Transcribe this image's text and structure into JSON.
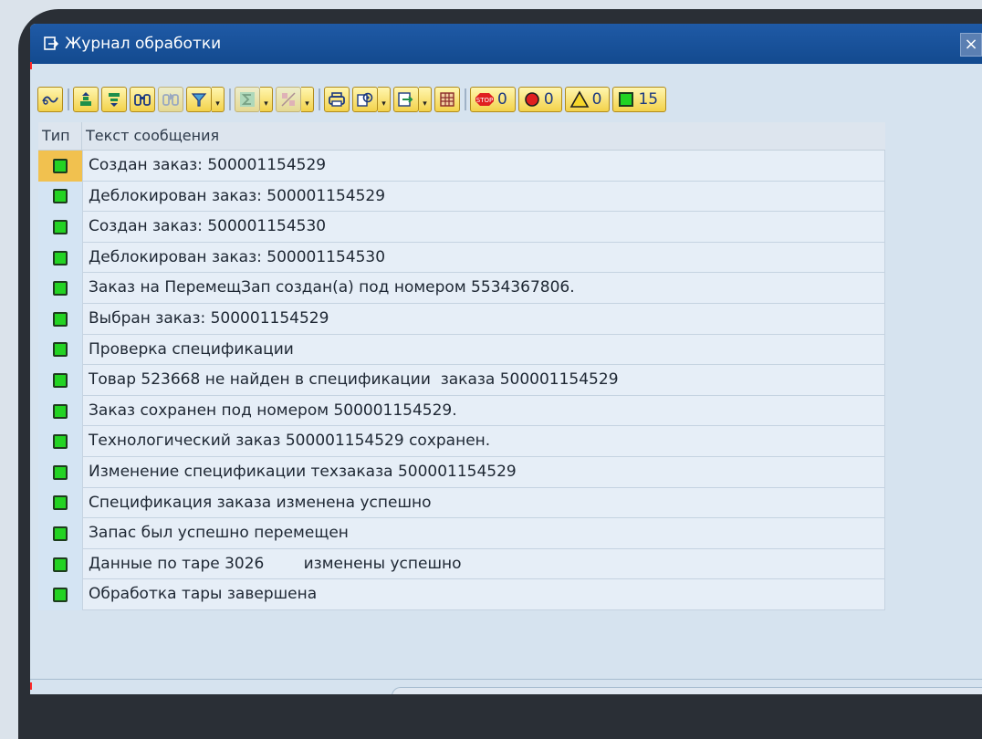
{
  "window": {
    "title": "Журнал обработки",
    "close_label": "×"
  },
  "toolbar": {
    "counts": {
      "errors_stop": "0",
      "errors": "0",
      "warnings": "0",
      "success": "15"
    },
    "icons": [
      "details-icon",
      "sort-ascending-icon",
      "sort-descending-icon",
      "find-icon",
      "find-next-icon",
      "filter-icon",
      "sum-icon",
      "subtotal-icon",
      "print-icon",
      "change-layout-icon",
      "export-icon",
      "select-layout-icon"
    ]
  },
  "table": {
    "headers": {
      "type": "Тип",
      "text": "Текст сообщения"
    },
    "rows": [
      {
        "type": "success",
        "text": "Создан заказ: 500001154529"
      },
      {
        "type": "success",
        "text": "Деблокирован заказ: 500001154529"
      },
      {
        "type": "success",
        "text": "Создан заказ: 500001154530"
      },
      {
        "type": "success",
        "text": "Деблокирован заказ: 500001154530"
      },
      {
        "type": "success",
        "text": "Заказ на ПеремещЗап создан(а) под номером 5534367806."
      },
      {
        "type": "success",
        "text": "Выбран заказ: 500001154529"
      },
      {
        "type": "success",
        "text": "Проверка спецификации"
      },
      {
        "type": "success",
        "text": "Товар 523668 не найден в спецификации  заказа 500001154529"
      },
      {
        "type": "success",
        "text": "Заказ сохранен под номером 500001154529."
      },
      {
        "type": "success",
        "text": "Технологический заказ 500001154529 сохранен."
      },
      {
        "type": "success",
        "text": "Изменение спецификации техзаказа 500001154529"
      },
      {
        "type": "success",
        "text": "Спецификация заказа изменена успешно"
      },
      {
        "type": "success",
        "text": "Запас был успешно перемещен"
      },
      {
        "type": "success",
        "text": "Данные по таре 3026        изменены успешно"
      },
      {
        "type": "success",
        "text": "Обработка тары завершена"
      }
    ]
  },
  "colors": {
    "title_bar": "#1f5aa6",
    "success_light": "#23d323",
    "selected_cell": "#f1c14f",
    "error_red": "#e02020",
    "warning_yellow": "#f6d62a"
  }
}
